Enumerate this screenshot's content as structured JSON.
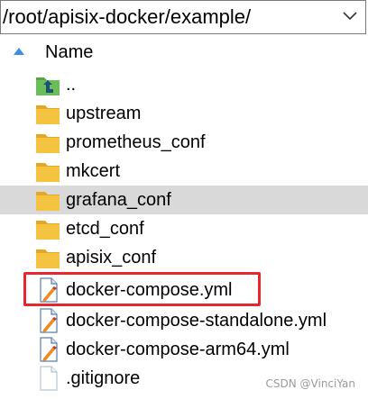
{
  "path_bar": {
    "path": "/root/apisix-docker/example/"
  },
  "file_list": {
    "column_header": "Name",
    "rows": [
      {
        "name": "..",
        "type": "parent",
        "icon": "folder-up-icon"
      },
      {
        "name": "upstream",
        "type": "folder",
        "icon": "folder-icon"
      },
      {
        "name": "prometheus_conf",
        "type": "folder",
        "icon": "folder-icon"
      },
      {
        "name": "mkcert",
        "type": "folder",
        "icon": "folder-icon"
      },
      {
        "name": "grafana_conf",
        "type": "folder",
        "icon": "folder-icon",
        "selected": true
      },
      {
        "name": "etcd_conf",
        "type": "folder",
        "icon": "folder-icon"
      },
      {
        "name": "apisix_conf",
        "type": "folder",
        "icon": "folder-icon"
      },
      {
        "name": "docker-compose.yml",
        "type": "file",
        "icon": "yaml-file-icon",
        "highlighted": true
      },
      {
        "name": "docker-compose-standalone.yml",
        "type": "file",
        "icon": "yaml-file-icon"
      },
      {
        "name": "docker-compose-arm64.yml",
        "type": "file",
        "icon": "yaml-file-icon"
      },
      {
        "name": ".gitignore",
        "type": "file",
        "icon": "blank-file-icon"
      }
    ]
  },
  "colors": {
    "folder": "#f5c342",
    "selected_row": "#d9d9d9",
    "highlight_border": "#e8262d",
    "sort_arrow": "#3c8fde"
  },
  "watermark": "CSDN @VinciYan"
}
